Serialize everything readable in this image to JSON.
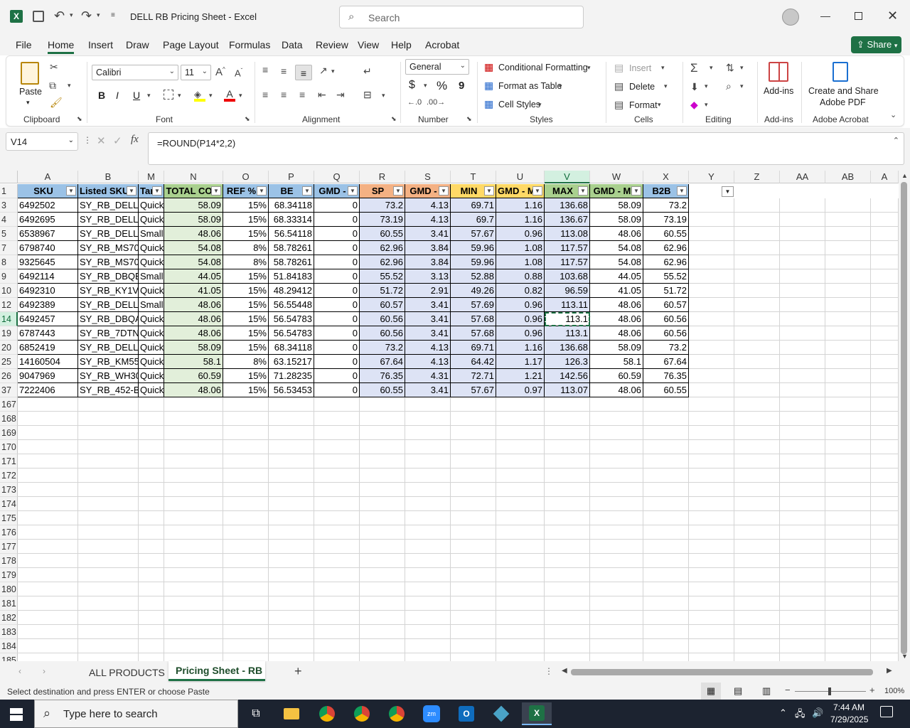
{
  "titlebar": {
    "doc_title": "DELL RB Pricing Sheet  -  Excel",
    "search_placeholder": "Search"
  },
  "menu": {
    "tabs": [
      "File",
      "Home",
      "Insert",
      "Draw",
      "Page Layout",
      "Formulas",
      "Data",
      "Review",
      "View",
      "Help",
      "Acrobat"
    ],
    "share": "Share"
  },
  "ribbon": {
    "clipboard": {
      "paste": "Paste",
      "label": "Clipboard"
    },
    "font": {
      "name": "Calibri",
      "size": "11",
      "label": "Font",
      "bold": "B",
      "italic": "I",
      "underline": "U"
    },
    "alignment": {
      "label": "Alignment"
    },
    "number": {
      "format": "General",
      "label": "Number",
      "currency": "$",
      "percent": "%",
      "comma": "9"
    },
    "styles": {
      "cond": "Conditional Formatting",
      "table": "Format as Table",
      "cellstyles": "Cell Styles",
      "label": "Styles"
    },
    "cells": {
      "insert": "Insert",
      "delete": "Delete",
      "format": "Format",
      "label": "Cells"
    },
    "editing": {
      "label": "Editing"
    },
    "addins": {
      "btn": "Add-ins",
      "label": "Add-ins"
    },
    "acrobat": {
      "btn1": "Create and Share",
      "btn2": "Adobe PDF",
      "label": "Adobe Acrobat"
    }
  },
  "formula_bar": {
    "name_box": "V14",
    "formula": "=ROUND(P14*2,2)"
  },
  "columns": [
    "A",
    "B",
    "M",
    "N",
    "O",
    "P",
    "Q",
    "R",
    "S",
    "T",
    "U",
    "V",
    "W",
    "X",
    "Y",
    "Z",
    "AA",
    "AB",
    "A"
  ],
  "headers": [
    "SKU",
    "Listed SKU",
    "Tar",
    "TOTAL CO",
    "REF %",
    "BE",
    "GMD -",
    "SP",
    "GMD -",
    "MIN",
    "GMD - M",
    "MAX",
    "GMD - M",
    "B2B"
  ],
  "rows": [
    {
      "r": "3",
      "v": [
        "6492502",
        "SY_RB_DELL-(",
        "Quick",
        "58.09",
        "15%",
        "68.34118",
        "0",
        "73.2",
        "4.13",
        "69.71",
        "1.16",
        "136.68",
        "58.09",
        "73.2"
      ]
    },
    {
      "r": "4",
      "v": [
        "6492695",
        "SY_RB_DELL-F",
        "Quick",
        "58.09",
        "15%",
        "68.33314",
        "0",
        "73.19",
        "4.13",
        "69.7",
        "1.16",
        "136.67",
        "58.09",
        "73.19"
      ]
    },
    {
      "r": "5",
      "v": [
        "6538967",
        "SY_RB_DELL-F",
        "Small",
        "48.06",
        "15%",
        "56.54118",
        "0",
        "60.55",
        "3.41",
        "57.67",
        "0.96",
        "113.08",
        "48.06",
        "60.55"
      ]
    },
    {
      "r": "7",
      "v": [
        "6798740",
        "SY_RB_MS70(",
        "Quick",
        "54.08",
        "8%",
        "58.78261",
        "0",
        "62.96",
        "3.84",
        "59.96",
        "1.08",
        "117.57",
        "54.08",
        "62.96"
      ]
    },
    {
      "r": "8",
      "v": [
        "9325645",
        "SY_RB_MS70(",
        "Quick",
        "54.08",
        "8%",
        "58.78261",
        "0",
        "62.96",
        "3.84",
        "59.96",
        "1.08",
        "117.57",
        "54.08",
        "62.96"
      ]
    },
    {
      "r": "9",
      "v": [
        "6492114",
        "SY_RB_DBQB",
        "Small",
        "44.05",
        "15%",
        "51.84183",
        "0",
        "55.52",
        "3.13",
        "52.88",
        "0.88",
        "103.68",
        "44.05",
        "55.52"
      ]
    },
    {
      "r": "10",
      "v": [
        "6492310",
        "SY_RB_KY1V8",
        "Quick",
        "41.05",
        "15%",
        "48.29412",
        "0",
        "51.72",
        "2.91",
        "49.26",
        "0.82",
        "96.59",
        "41.05",
        "51.72"
      ]
    },
    {
      "r": "12",
      "v": [
        "6492389",
        "SY_RB_DELL-F",
        "Small",
        "48.06",
        "15%",
        "56.55448",
        "0",
        "60.57",
        "3.41",
        "57.69",
        "0.96",
        "113.11",
        "48.06",
        "60.57"
      ]
    },
    {
      "r": "14",
      "v": [
        "6492457",
        "SY_RB_DBQA",
        "Quick",
        "48.06",
        "15%",
        "56.54783",
        "0",
        "60.56",
        "3.41",
        "57.68",
        "0.96",
        "113.1",
        "48.06",
        "60.56"
      ]
    },
    {
      "r": "19",
      "v": [
        "6787443",
        "SY_RB_7DTN",
        "Quick",
        "48.06",
        "15%",
        "56.54783",
        "0",
        "60.56",
        "3.41",
        "57.68",
        "0.96",
        "113.1",
        "48.06",
        "60.56"
      ]
    },
    {
      "r": "20",
      "v": [
        "6852419",
        "SY_RB_DELL-S",
        "Quick",
        "58.09",
        "15%",
        "68.34118",
        "0",
        "73.2",
        "4.13",
        "69.71",
        "1.16",
        "136.68",
        "58.09",
        "73.2"
      ]
    },
    {
      "r": "25",
      "v": [
        "14160504",
        "SY_RB_KM555",
        "Quick",
        "58.1",
        "8%",
        "63.15217",
        "0",
        "67.64",
        "4.13",
        "64.42",
        "1.17",
        "126.3",
        "58.1",
        "67.64"
      ]
    },
    {
      "r": "26",
      "v": [
        "9047969",
        "SY_RB_WH30",
        "Quick",
        "60.59",
        "15%",
        "71.28235",
        "0",
        "76.35",
        "4.31",
        "72.71",
        "1.21",
        "142.56",
        "60.59",
        "76.35"
      ]
    },
    {
      "r": "37",
      "v": [
        "7222406",
        "SY_RB_452-BI",
        "Quick",
        "48.06",
        "15%",
        "56.53453",
        "0",
        "60.55",
        "3.41",
        "57.67",
        "0.97",
        "113.07",
        "48.06",
        "60.55"
      ]
    }
  ],
  "empty_rows": [
    "167",
    "168",
    "169",
    "170",
    "171",
    "172",
    "173",
    "174",
    "175",
    "176",
    "177",
    "178",
    "179",
    "180",
    "181",
    "182",
    "183",
    "184",
    "185"
  ],
  "sheets": {
    "tab1": "ALL PRODUCTS",
    "tab2": "Pricing Sheet - RB",
    "add": "+"
  },
  "status": {
    "text": "Select destination and press ENTER or choose Paste",
    "zoom": "100%"
  },
  "taskbar": {
    "search_placeholder": "Type here to search",
    "time": "7:44 AM",
    "date": "7/29/2025"
  },
  "colors": {
    "excel_green": "#1e7145",
    "hdr_blue": "#9bc2e6",
    "hdr_green": "#a9d08e",
    "hdr_orange": "#f4b183",
    "hdr_yellow": "#ffd966",
    "fill_green": "#e2efda",
    "fill_lavender": "#dde3f5"
  }
}
